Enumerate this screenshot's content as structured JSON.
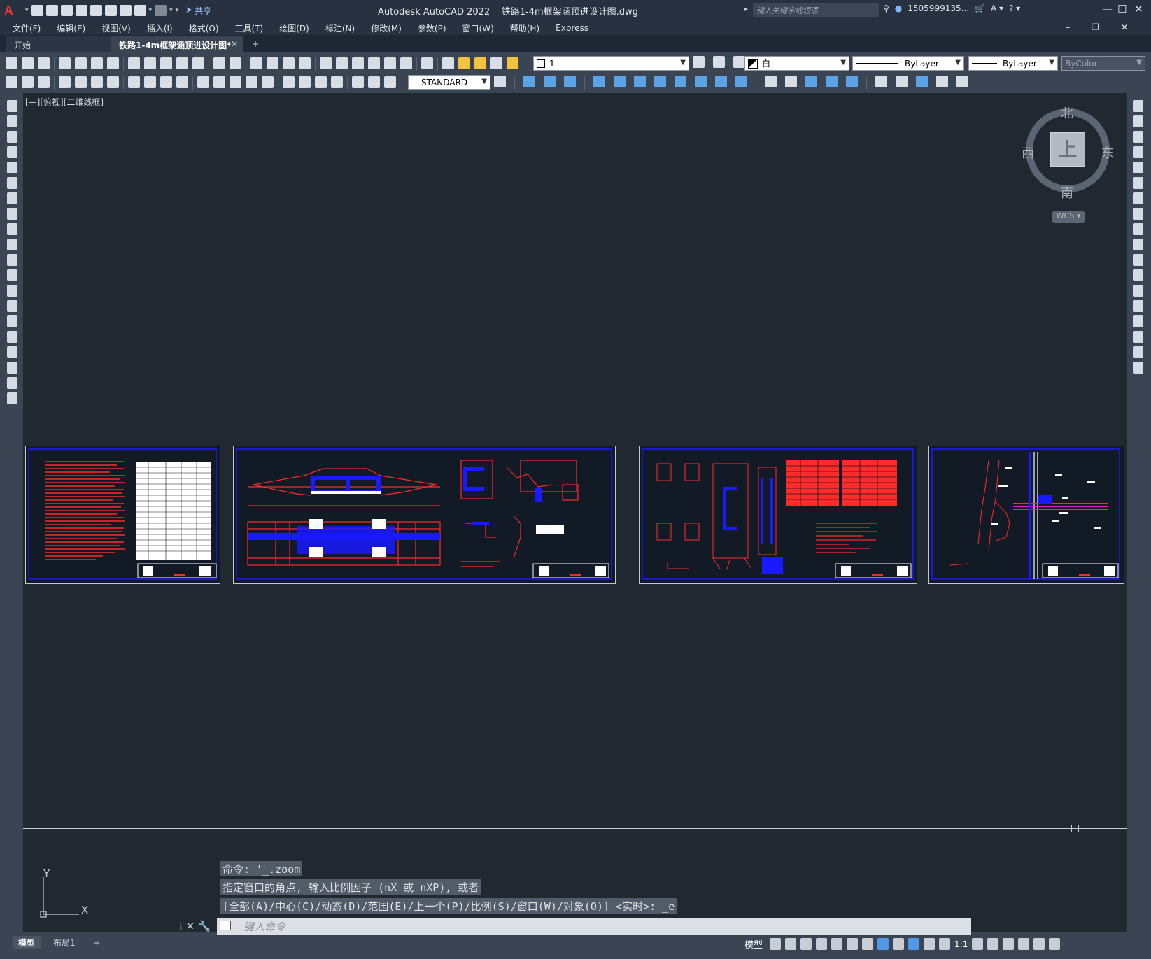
{
  "app": {
    "logo": "A",
    "title": "Autodesk AutoCAD 2022",
    "file": "铁路1-4m框架涵顶进设计图.dwg",
    "search_placeholder": "键入关键字或短语",
    "user": "1505999135...",
    "share_label": "共享"
  },
  "menu": [
    "文件(F)",
    "编辑(E)",
    "视图(V)",
    "插入(I)",
    "格式(O)",
    "工具(T)",
    "绘图(D)",
    "标注(N)",
    "修改(M)",
    "参数(P)",
    "窗口(W)",
    "帮助(H)",
    "Express"
  ],
  "tabs": {
    "start": "开始",
    "active": "铁路1-4m框架涵顶进设计图*",
    "close": "✕",
    "add": "+"
  },
  "properties": {
    "layer": "1",
    "color": "白",
    "linetype": "ByLayer",
    "lineweight": "ByLayer",
    "plotstyle": "ByColor",
    "textstyle": "STANDARD"
  },
  "viewport": {
    "label": "[—][俯视][二维线框]"
  },
  "viewcube": {
    "top": "上",
    "north": "北",
    "south": "南",
    "west": "西",
    "east": "东",
    "wcs": "WCS ▾"
  },
  "ucs": {
    "x": "X",
    "y": "Y"
  },
  "command": {
    "history": [
      "命令: '_.zoom",
      "指定窗口的角点, 输入比例因子 (nX 或 nXP), 或者",
      "[全部(A)/中心(C)/动态(D)/范围(E)/上一个(P)/比例(S)/窗口(W)/对象(O)] <实时>: _e"
    ],
    "placeholder": "键入命令"
  },
  "layout_tabs": [
    "模型",
    "布局1",
    "+"
  ],
  "statusbar": {
    "model": "模型",
    "scale": "1:1"
  },
  "colors": {
    "drawing_red": "#ff1a1a",
    "drawing_blue": "#1a1aff",
    "drawing_white": "#ffffff",
    "accent": "#4e9ae6"
  }
}
